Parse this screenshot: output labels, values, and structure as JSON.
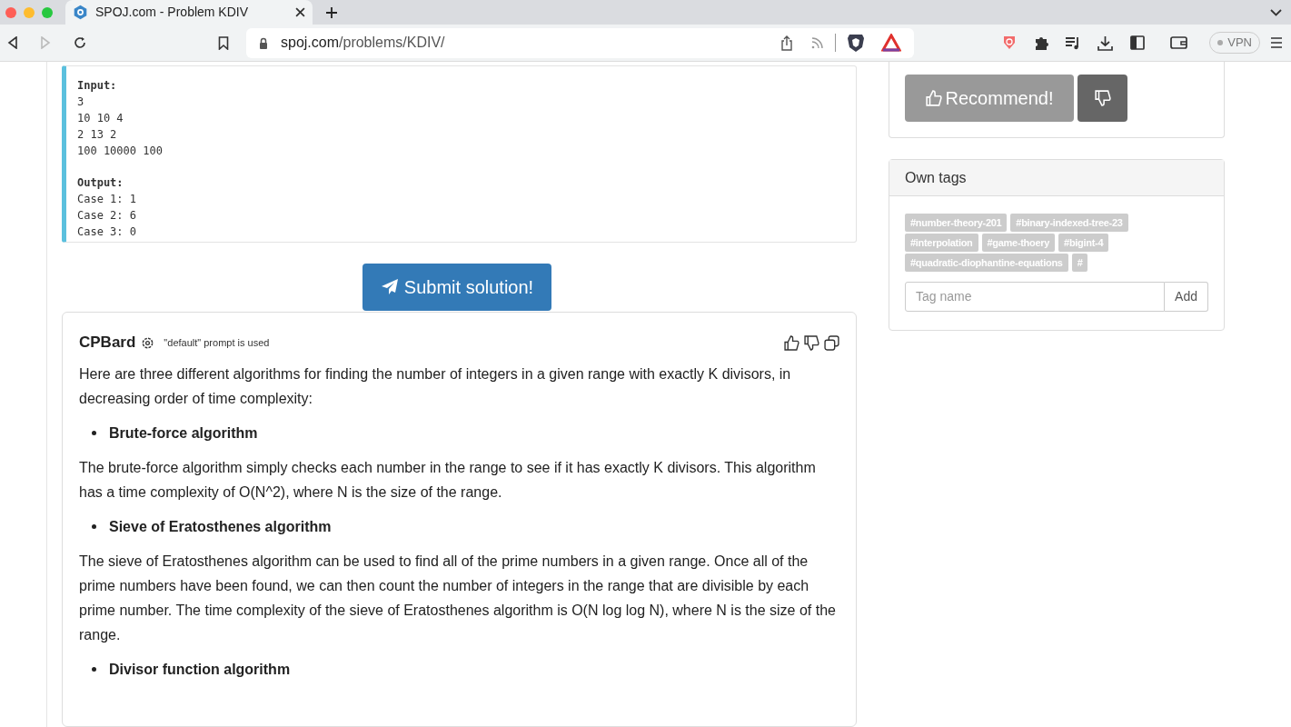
{
  "browser": {
    "tab_title": "SPOJ.com - Problem KDIV",
    "address": {
      "host": "spoj.com",
      "path": "/problems/KDIV/"
    },
    "vpn": "VPN"
  },
  "example": {
    "input_label": "Input:",
    "input_lines": [
      "3",
      "10 10 4",
      "2 13 2",
      "100 10000 100"
    ],
    "output_label": "Output:",
    "output_lines": [
      "Case 1: 1",
      "Case 2: 6",
      "Case 3: 0"
    ]
  },
  "submit": "Submit solution!",
  "cpbard": {
    "title": "CPBard",
    "note": "\"default\" prompt is used",
    "blocks": [
      {
        "kind": "paragraph",
        "text": "Here are three different algorithms for finding the number of integers in a given range with exactly K divisors, in decreasing order of time complexity:"
      },
      {
        "kind": "bullet",
        "text": "Brute-force algorithm"
      },
      {
        "kind": "paragraph",
        "text": "The brute-force algorithm simply checks each number in the range to see if it has exactly K divisors. This algorithm has a time complexity of O(N^2), where N is the size of the range."
      },
      {
        "kind": "bullet",
        "text": "Sieve of Eratosthenes algorithm"
      },
      {
        "kind": "paragraph",
        "text": "The sieve of Eratosthenes algorithm can be used to find all of the prime numbers in a given range. Once all of the prime numbers have been found, we can then count the number of integers in the range that are divisible by each prime number. The time complexity of the sieve of Eratosthenes algorithm is O(N log log N), where N is the size of the range."
      },
      {
        "kind": "bullet",
        "text": "Divisor function algorithm"
      }
    ]
  },
  "recommend": {
    "label": "Recommend!"
  },
  "own_tags": {
    "title": "Own tags",
    "tags": [
      "#number-theory-201",
      "#binary-indexed-tree-23",
      "#interpolation",
      "#game-thoery",
      "#bigint-4",
      "#quadratic-diophantine-equations",
      "#"
    ],
    "placeholder": "Tag name",
    "add": "Add"
  }
}
